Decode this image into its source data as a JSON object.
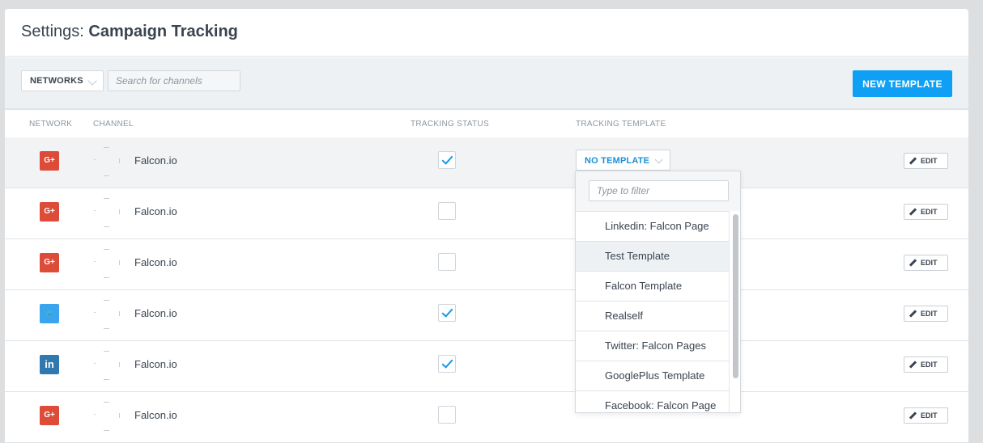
{
  "header": {
    "prefix": "Settings:",
    "title": "Campaign Tracking"
  },
  "toolbar": {
    "networks_label": "NETWORKS",
    "search_placeholder": "Search for channels",
    "new_template_label": "NEW TEMPLATE"
  },
  "columns": {
    "network": "NETWORK",
    "channel": "CHANNEL",
    "tracking_status": "TRACKING STATUS",
    "tracking_template": "TRACKING TEMPLATE"
  },
  "rows": [
    {
      "network_icon": "google-plus-icon",
      "network_glyph": "G+",
      "channel": "Falcon.io",
      "tracking": true,
      "edit_label": "EDIT"
    },
    {
      "network_icon": "google-plus-icon",
      "network_glyph": "G+",
      "channel": "Falcon.io",
      "tracking": false,
      "edit_label": "EDIT"
    },
    {
      "network_icon": "google-plus-icon",
      "network_glyph": "G+",
      "channel": "Falcon.io",
      "tracking": false,
      "edit_label": "EDIT"
    },
    {
      "network_icon": "twitter-icon",
      "network_glyph": "🐦",
      "channel": "Falcon.io",
      "tracking": true,
      "edit_label": "EDIT"
    },
    {
      "network_icon": "linkedin-icon",
      "network_glyph": "in",
      "channel": "Falcon.io",
      "tracking": true,
      "edit_label": "EDIT"
    },
    {
      "network_icon": "google-plus-icon",
      "network_glyph": "G+",
      "channel": "Falcon.io",
      "tracking": false,
      "edit_label": "EDIT"
    }
  ],
  "template_dropdown": {
    "selected": "NO TEMPLATE",
    "filter_placeholder": "Type to filter",
    "options": [
      "Linkedin: Falcon Page",
      "Test Template",
      "Falcon Template",
      "Realself",
      "Twitter: Falcon Pages",
      "GooglePlus Template",
      "Facebook: Falcon Page"
    ]
  },
  "colors": {
    "accent": "#0fa0f5",
    "google_plus": "#dd4b39",
    "twitter": "#3aa4ee",
    "linkedin": "#2f79b0"
  }
}
